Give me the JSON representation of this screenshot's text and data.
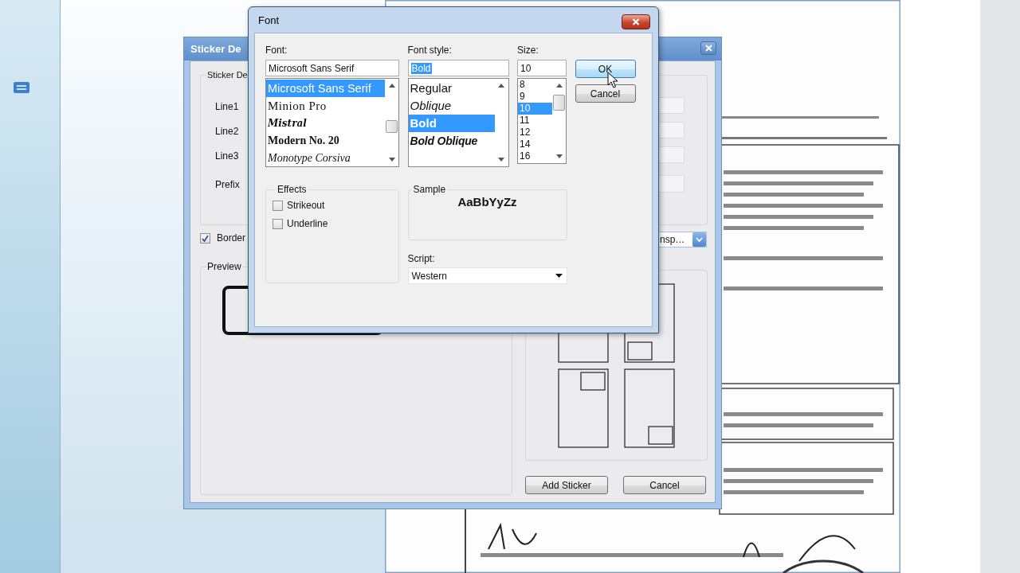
{
  "sticker_dialog": {
    "title": "Sticker De",
    "group_title": "Sticker De",
    "fields": [
      {
        "label": "Line1"
      },
      {
        "label": "Line2"
      },
      {
        "label": "Line3"
      },
      {
        "label": "Prefix"
      }
    ],
    "border": {
      "label": "Border",
      "checked": true
    },
    "combo": {
      "value": "nsp…"
    },
    "preview": {
      "title": "Preview"
    },
    "layouts": [
      {
        "kind": "none"
      },
      {
        "kind": "bottom-left"
      },
      {
        "kind": "top-right"
      },
      {
        "kind": "bottom-right"
      }
    ],
    "buttons": [
      "Add Sticker",
      "Cancel"
    ]
  },
  "font_dialog": {
    "title": "Font",
    "font": {
      "label": "Font:",
      "value": "Microsoft Sans Serif",
      "items": [
        {
          "label": "Microsoft Sans Serif",
          "kind": "sans",
          "selected": true
        },
        {
          "label": "Minion Pro",
          "kind": "serif",
          "selected": false
        },
        {
          "label": "Mistral",
          "kind": "script",
          "selected": false
        },
        {
          "label": "Modern No. 20",
          "kind": "bold-serif",
          "selected": false
        },
        {
          "label": "Monotype Corsiva",
          "kind": "italic-serif",
          "selected": false
        }
      ]
    },
    "style": {
      "label": "Font style:",
      "value": "Bold",
      "value_selected": true,
      "items": [
        {
          "label": "Regular",
          "kind": "regular",
          "selected": false
        },
        {
          "label": "Oblique",
          "kind": "italic",
          "selected": false
        },
        {
          "label": "Bold",
          "kind": "bold",
          "selected": true
        },
        {
          "label": "Bold Oblique",
          "kind": "bold-italic",
          "selected": false
        }
      ]
    },
    "size": {
      "label": "Size:",
      "value": "10",
      "items": [
        {
          "label": "8",
          "selected": false
        },
        {
          "label": "9",
          "selected": false
        },
        {
          "label": "10",
          "selected": true
        },
        {
          "label": "11",
          "selected": false
        },
        {
          "label": "12",
          "selected": false
        },
        {
          "label": "14",
          "selected": false
        },
        {
          "label": "16",
          "selected": false
        }
      ]
    },
    "buttons": [
      {
        "label": "OK",
        "hovered": true
      },
      {
        "label": "Cancel",
        "hovered": false
      }
    ],
    "effects": {
      "title": "Effects",
      "options": [
        {
          "label": "Strikeout",
          "checked": false
        },
        {
          "label": "Underline",
          "checked": false
        }
      ]
    },
    "sample": {
      "title": "Sample",
      "text": "AaBbYyZz"
    },
    "script": {
      "label": "Script:",
      "value": "Western"
    }
  }
}
